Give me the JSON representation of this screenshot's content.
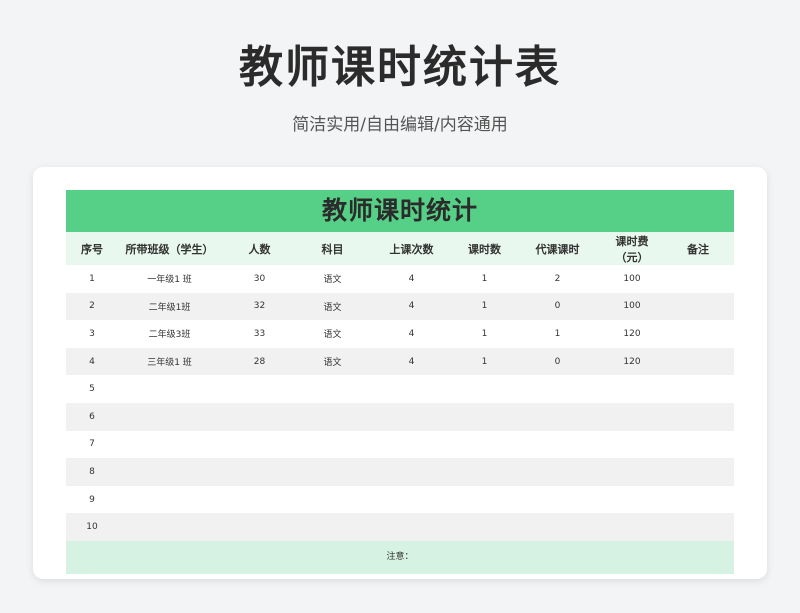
{
  "page": {
    "title": "教师课时统计表",
    "subtitle": "简洁实用/自由编辑/内容通用"
  },
  "sheet": {
    "title": "教师课时统计",
    "headers": [
      "序号",
      "所带班级（学生）",
      "人数",
      "科目",
      "上课次数",
      "课时数",
      "代课课时",
      "课时费（元）",
      "备注"
    ],
    "rows": [
      [
        "1",
        "一年级1 班",
        "30",
        "语文",
        "4",
        "1",
        "2",
        "100",
        ""
      ],
      [
        "2",
        "二年级1班",
        "32",
        "语文",
        "4",
        "1",
        "0",
        "100",
        ""
      ],
      [
        "3",
        "二年级3班",
        "33",
        "语文",
        "4",
        "1",
        "1",
        "120",
        ""
      ],
      [
        "4",
        "三年级1 班",
        "28",
        "语文",
        "4",
        "1",
        "0",
        "120",
        ""
      ],
      [
        "5",
        "",
        "",
        "",
        "",
        "",
        "",
        "",
        ""
      ],
      [
        "6",
        "",
        "",
        "",
        "",
        "",
        "",
        "",
        ""
      ],
      [
        "7",
        "",
        "",
        "",
        "",
        "",
        "",
        "",
        ""
      ],
      [
        "8",
        "",
        "",
        "",
        "",
        "",
        "",
        "",
        ""
      ],
      [
        "9",
        "",
        "",
        "",
        "",
        "",
        "",
        "",
        ""
      ],
      [
        "10",
        "",
        "",
        "",
        "",
        "",
        "",
        "",
        ""
      ]
    ],
    "note": "注意："
  },
  "colors": {
    "title_bar": "#57d087",
    "header_bg": "#e9f8ee",
    "stripe": "#f1f1f1",
    "note_bg": "#d6f2e2"
  }
}
